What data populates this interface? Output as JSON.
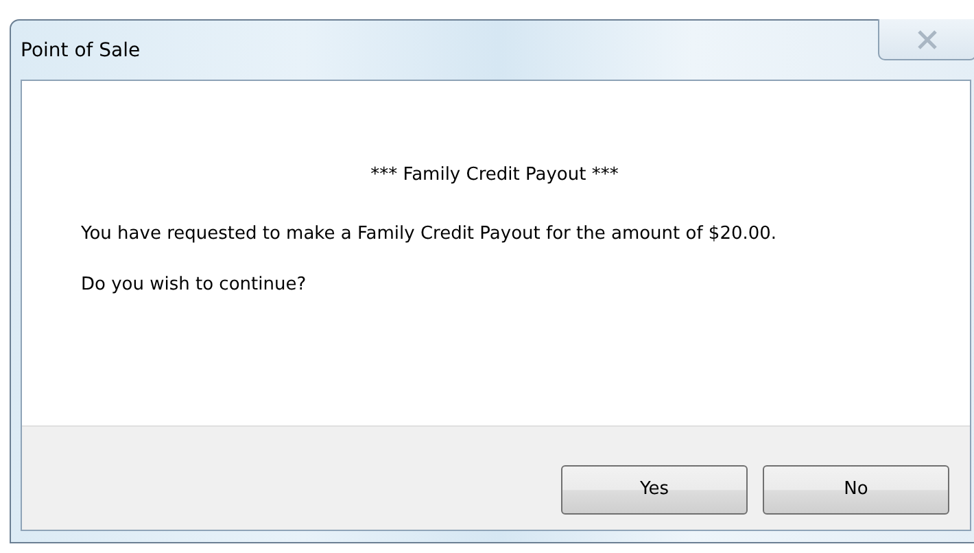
{
  "window": {
    "title": "Point of Sale",
    "close_disabled": true
  },
  "message": {
    "heading": "*** Family Credit Payout ***",
    "paragraphs": [
      "You have requested to make a Family Credit Payout for the amount of $20.00.",
      "Do you wish to continue?"
    ]
  },
  "buttons": [
    {
      "label": "Yes"
    },
    {
      "label": "No"
    }
  ]
}
